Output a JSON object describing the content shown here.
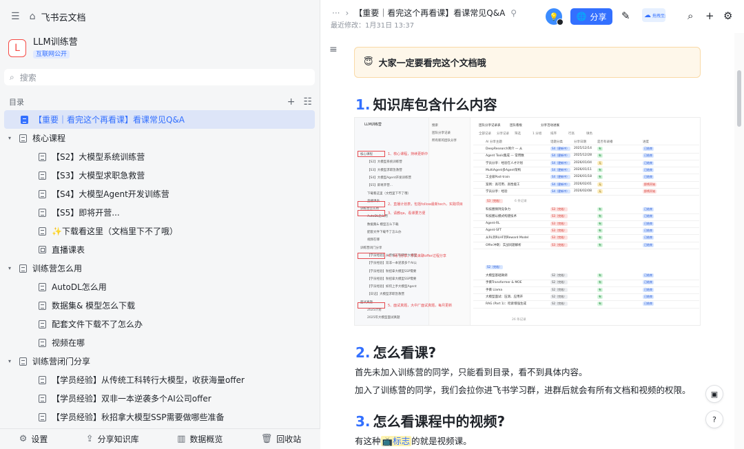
{
  "sidebar": {
    "top": {
      "collapse_icon": "sidebar-collapse-icon",
      "home_icon": "home-icon",
      "home_label": "飞书云文档"
    },
    "space": {
      "logo_letter": "L",
      "name": "LLM训练营",
      "badge": "互联网公开"
    },
    "search": {
      "placeholder": "搜索",
      "icon": "search-icon"
    },
    "toc_label": "目录",
    "tree": [
      {
        "label": "【重要｜看完这个再看课】看课常见Q&A",
        "level": 0,
        "active": true,
        "caret": "",
        "kind": "doc"
      },
      {
        "label": "核心课程",
        "level": 0,
        "caret": "▾",
        "kind": "doc"
      },
      {
        "label": "【S2】大模型系统训练营",
        "level": 1,
        "caret": "",
        "kind": "doc"
      },
      {
        "label": "【S3】大模型求职急救营",
        "level": 1,
        "caret": "",
        "kind": "doc"
      },
      {
        "label": "【S4】大模型Agent开发训练营",
        "level": 1,
        "caret": "",
        "kind": "doc"
      },
      {
        "label": "【S5】即将开营...",
        "level": 1,
        "caret": "",
        "kind": "doc"
      },
      {
        "label": "✨下载看这里（文档里下不了哦）",
        "level": 1,
        "caret": "",
        "kind": "doc"
      },
      {
        "label": "直播课表",
        "level": 1,
        "caret": "",
        "kind": "grid"
      },
      {
        "label": "训练营怎么用",
        "level": 0,
        "caret": "▾",
        "kind": "doc"
      },
      {
        "label": "AutoDL怎么用",
        "level": 1,
        "caret": "",
        "kind": "doc"
      },
      {
        "label": "数据集& 模型怎么下载",
        "level": 1,
        "caret": "",
        "kind": "doc"
      },
      {
        "label": "配套文件下载不了怎么办",
        "level": 1,
        "caret": "",
        "kind": "doc"
      },
      {
        "label": "视频在哪",
        "level": 1,
        "caret": "",
        "kind": "doc"
      },
      {
        "label": "训练营闭门分享",
        "level": 0,
        "caret": "▾",
        "kind": "doc"
      },
      {
        "label": "【学员经验】从传统工科转行大模型，收获海量offer",
        "level": 1,
        "caret": "",
        "kind": "doc"
      },
      {
        "label": "【学员经验】双非一本逆袭多个AI公司offer",
        "level": 1,
        "caret": "",
        "kind": "doc"
      },
      {
        "label": "【学员经验】秋招拿大模型SSP需要做哪些准备",
        "level": 1,
        "caret": "",
        "kind": "doc"
      }
    ],
    "bottom": [
      {
        "label": "设置",
        "icon": "gear-icon"
      },
      {
        "label": "分享知识库",
        "icon": "share-icon"
      },
      {
        "label": "数据概览",
        "icon": "chart-icon"
      },
      {
        "label": "回收站",
        "icon": "trash-icon"
      }
    ]
  },
  "header": {
    "more": "···",
    "title": "【重要｜看完这个再看课】看课常见Q&A",
    "last_edited": "最近修改：1月31日 13:37",
    "share_label": "分享",
    "promo_text": "拖拽至此上传"
  },
  "doc": {
    "callout_emoji": "😇",
    "callout_text": "大家一定要看完这个文档哦",
    "s1": {
      "num": "1.",
      "title": "知识库包含什么内容"
    },
    "s2": {
      "num": "2.",
      "title": "怎么看课?"
    },
    "p1": "首先未加入训练营的同学，只能看到目录，看不到具体内容。",
    "p2": "加入了训练营的同学，我们会拉你进飞书学习群，进群后就会有所有文档和视频的权限。",
    "s3": {
      "num": "3.",
      "title": "怎么看课程中的视频?"
    },
    "p3_prefix": "有这种",
    "p3_tag": "标志",
    "p3_suffix": "的就是视频课。"
  },
  "shot": {
    "space_name": "LLM训练营",
    "left_rows": [
      "核心课程",
      "【S2】大模型系统训练营",
      "【S3】大模型求职急救营",
      "【S4】大模型Agent开发训练营",
      "【S5】即将开营...",
      "下载看这里（文档里下不了哦）",
      "直播课表",
      "训练营怎么用",
      "AutoDL怎么用",
      "数据集& 模型怎么下载",
      "配套文件下载不了怎么办",
      "视频在哪",
      "训练营闭门分享",
      "【学员经验】从传统工科转行大模型",
      "【学员经验】双非一本逆袭多个AI公",
      "【学员经验】秋招拿大模型SSP需要",
      "【学员经验】秋招拿大模型SSP需要",
      "【学员经验】如何上手大模型Agent",
      "【日记】大模型求职急救营",
      "面试真题",
      "2025计划",
      "2025年大模型面试真题"
    ],
    "annotations": [
      "1、核心课程，持续更新中",
      "2、直播计划表，包括follow最新tech，实践项目",
      "3、请教qa，看课要方便",
      "4、闭门分享，学员来聊offer过程分享",
      "5、面试真题，大中厂面试真题，每月更新"
    ],
    "mid_rows": [
      "搜索",
      "团队分享记录",
      "所有新的团队分享"
    ],
    "tabs": [
      "团队分享记录表",
      "团队看板",
      "分享活动进展"
    ],
    "toolbar": [
      "全部记录",
      "分享记录",
      "筛选",
      "1 分组",
      "排序",
      "行高",
      "填色"
    ],
    "columns": [
      "AI 分享主题",
      "话题分类",
      "分享日期",
      "是否有录播",
      "进度"
    ],
    "group1_rows": [
      "DeepResearch简介 — 从",
      "Agent Tools集成 — 常用数",
      "学员分享：经验在人才计划",
      "MultiAgent多Agent架构",
      "工业级Post-train",
      "案例：高可用、高性能工",
      "学员分享：经验"
    ],
    "group2_rows": [
      "科技圈保持竞争力",
      "科技圈以模式构建技术",
      "Agent-RL",
      "Agent-SFT",
      "从RL到RLHF到Reward Model",
      "Offer冲刺：实战问题解析"
    ],
    "group3_rows": [
      "大模型基础微调",
      "手撕Transformer & MOE",
      "手撕 Llama",
      "大模型面试：压测、应用开",
      "RAG (Part 1)：检索增强生成"
    ],
    "dates": [
      "2025/12/14",
      "2025/12/28",
      "2026/01/04",
      "2026/01/11",
      "2026/01/18",
      "2026/02/01",
      "2026/02/08"
    ],
    "s4_tag": "S4（更新中）",
    "s3_tag": "S3（完结）",
    "s2_tag": "S2（完结）",
    "yes_tag": "有",
    "no_tag": "无",
    "done_tag": "已结束",
    "pending_tag": "即将开始",
    "group_s3": "S3（完结）",
    "group_s2": "S2（完结）",
    "group_count": "6 条记录",
    "group_count2": "26 条记录"
  }
}
